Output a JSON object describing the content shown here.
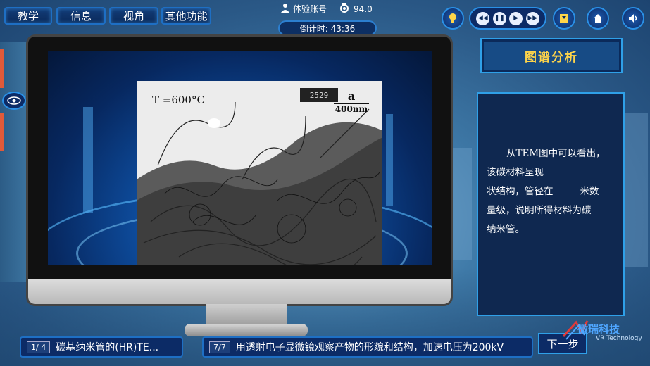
{
  "nav": {
    "items": [
      {
        "label": "教学"
      },
      {
        "label": "信息"
      },
      {
        "label": "视角"
      },
      {
        "label": "其他功能"
      }
    ]
  },
  "status": {
    "account_label": "体验账号",
    "score": "94.0",
    "timer": "倒计时: 43:36"
  },
  "colors": {
    "accent": "#2fa0e8",
    "title_text": "#ffd54a",
    "panel_bg": "#0f2850"
  },
  "figure": {
    "temperature_label": "T =600°C",
    "panel_letter": "a",
    "scale_bar": "400nm",
    "counter": "2529"
  },
  "analysis": {
    "title": "图谱分析",
    "line1": "从TEM图中可以看出，",
    "line2_a": "该碳材料呈现",
    "line3_a": "状结构，管径在",
    "line3_b": "米数",
    "line4": "量级，说明所得材料为碳",
    "line5": "纳米管。"
  },
  "bottom": {
    "left_page": "1/ 4",
    "left_text": "碳基纳米管的(HR)TE...",
    "right_page": "7/7",
    "right_text": "用透射电子显微镜观察产物的形貌和结构，加速电压为200kV",
    "next_label": "下一步"
  },
  "logo": {
    "name": "微瑞科技",
    "subtitle": "VR Technology"
  }
}
